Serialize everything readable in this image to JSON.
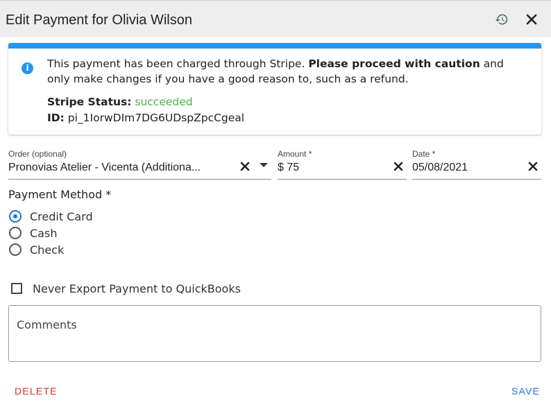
{
  "dialog": {
    "title": "Edit Payment for Olivia Wilson",
    "history_icon": "history-icon",
    "close_icon": "close-icon"
  },
  "alert": {
    "icon": "info-icon",
    "text_part1": "This payment has been charged through Stripe.",
    "text_bold": "Please proceed with caution",
    "text_part2": "and only make changes if you have a good reason to, such as a refund.",
    "status_label": "Stripe Status:",
    "status_value": "succeeded",
    "status_color": "#4caf50",
    "id_label": "ID:",
    "id_value": "pi_1IorwDIm7DG6UDspZpcCgeal",
    "accent_color": "#2196f3"
  },
  "fields": {
    "order": {
      "label": "Order (optional)",
      "value": "Pronovias Atelier - Vicenta (Additiona..."
    },
    "amount": {
      "label": "Amount *",
      "value": "$ 75"
    },
    "date": {
      "label": "Date *",
      "value": "05/08/2021"
    }
  },
  "payment_method": {
    "title": "Payment Method *",
    "options": [
      {
        "label": "Credit Card",
        "checked": true
      },
      {
        "label": "Cash",
        "checked": false
      },
      {
        "label": "Check",
        "checked": false
      }
    ]
  },
  "quickbooks": {
    "label": "Never Export Payment to QuickBooks",
    "checked": false
  },
  "comments": {
    "placeholder": "Comments"
  },
  "actions": {
    "delete_label": "DELETE",
    "delete_color": "#d32f2f",
    "save_label": "SAVE",
    "save_color": "#1976d2"
  }
}
